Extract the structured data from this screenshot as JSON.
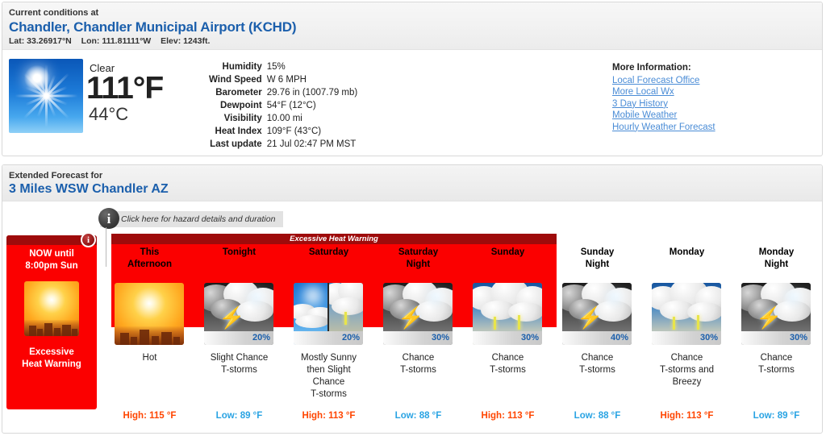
{
  "current": {
    "subtitle": "Current conditions at",
    "station": "Chandler, Chandler Municipal Airport (KCHD)",
    "lat": "Lat: 33.26917°N",
    "lon": "Lon: 111.81111°W",
    "elev": "Elev: 1243ft.",
    "condition": "Clear",
    "temp_f": "111°F",
    "temp_c": "44°C",
    "icon": "sun-clear-icon",
    "details": [
      {
        "label": "Humidity",
        "value": "15%"
      },
      {
        "label": "Wind Speed",
        "value": "W 6 MPH"
      },
      {
        "label": "Barometer",
        "value": "29.76 in (1007.79 mb)"
      },
      {
        "label": "Dewpoint",
        "value": "54°F (12°C)"
      },
      {
        "label": "Visibility",
        "value": "10.00 mi"
      },
      {
        "label": "Heat Index",
        "value": "109°F (43°C)"
      },
      {
        "label": "Last update",
        "value": "21 Jul 02:47 PM MST"
      }
    ],
    "more_info_title": "More Information:",
    "more_info_links": [
      "Local Forecast Office",
      "More Local Wx",
      "3 Day History",
      "Mobile Weather",
      "Hourly Weather Forecast"
    ]
  },
  "extended": {
    "subtitle": "Extended Forecast for",
    "location": "3 Miles WSW Chandler AZ",
    "hazard_button": "Click here for hazard details and duration",
    "hazard_band_title": "Excessive Heat Warning",
    "alert": {
      "when_line1": "NOW until",
      "when_line2": "8:00pm Sun",
      "label_line1": "Excessive",
      "label_line2": "Heat Warning",
      "icon": "hot-sun-city-icon",
      "badge": "i"
    },
    "periods": [
      {
        "day": "This\nAfternoon",
        "icon": "hot-sun-city-icon",
        "pop": "",
        "desc": "Hot",
        "temp_label": "High: 115 °F",
        "temp_type": "high"
      },
      {
        "day": "Tonight",
        "icon": "night-tstorms-icon",
        "pop": "20%",
        "desc": "Slight Chance\nT-storms",
        "temp_label": "Low: 89 °F",
        "temp_type": "low"
      },
      {
        "day": "Saturday",
        "icon": "sunny-then-tstorms-icon",
        "pop": "20%",
        "desc": "Mostly Sunny\nthen Slight\nChance\nT-storms",
        "temp_label": "High: 113 °F",
        "temp_type": "high"
      },
      {
        "day": "Saturday\nNight",
        "icon": "night-tstorms-icon",
        "pop": "30%",
        "desc": "Chance\nT-storms",
        "temp_label": "Low: 88 °F",
        "temp_type": "low"
      },
      {
        "day": "Sunday",
        "icon": "day-tstorms-icon",
        "pop": "30%",
        "desc": "Chance\nT-storms",
        "temp_label": "High: 113 °F",
        "temp_type": "high"
      },
      {
        "day": "Sunday\nNight",
        "icon": "night-tstorms-icon",
        "pop": "40%",
        "desc": "Chance\nT-storms",
        "temp_label": "Low: 88 °F",
        "temp_type": "low"
      },
      {
        "day": "Monday",
        "icon": "day-tstorms-icon",
        "pop": "30%",
        "desc": "Chance\nT-storms and\nBreezy",
        "temp_label": "High: 113 °F",
        "temp_type": "high"
      },
      {
        "day": "Monday\nNight",
        "icon": "night-tstorms-icon",
        "pop": "30%",
        "desc": "Chance\nT-storms",
        "temp_label": "Low: 89 °F",
        "temp_type": "low"
      }
    ]
  },
  "colors": {
    "link": "#4a8cd6",
    "heading": "#1b5fac",
    "alert_red": "#fb0000",
    "alert_dark_red": "#9e0b0b",
    "high_temp": "#ff4500",
    "low_temp": "#29a3e3",
    "pop_blue": "#1b5fac"
  }
}
